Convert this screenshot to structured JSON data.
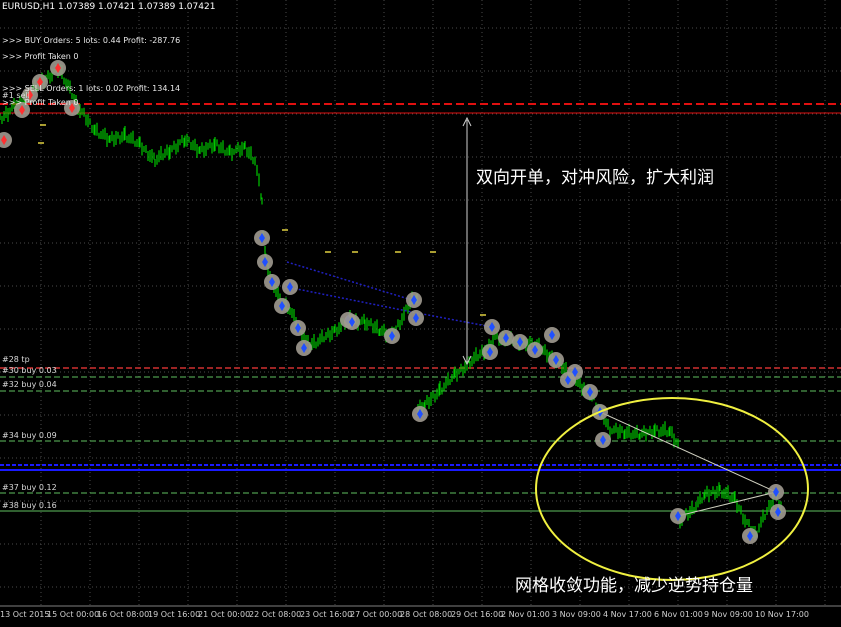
{
  "window": {
    "title": "EURUSD,H1  1.07389 1.07421 1.07389 1.07421"
  },
  "info": {
    "buy_line": ">>> BUY  Orders: 5 lots: 0.44 Profit: -287.76",
    "buy_taken": ">>> Profit Taken 0",
    "sell_line": ">>> SELL Orders: 1 lots: 0.02 Profit: 134.14",
    "sell_taken": ">>> Profit Taken 0"
  },
  "level_labels": {
    "top_sell": "#1 sell",
    "tp": "#28 tp",
    "buy30": "#30 buy 0.03",
    "buy32": "#32 buy 0.04",
    "buy34": "#34 buy 0.09",
    "buy37": "#37 buy 0.12",
    "buy38": "#38 buy 0.16"
  },
  "annotations": {
    "top": "双向开单，对冲风险，扩大利润",
    "bottom": "网格收敛功能，减少逆势持仓量"
  },
  "x_axis": [
    "13 Oct 2015",
    "15 Oct 00:00",
    "16 Oct 08:00",
    "19 Oct 16:00",
    "21 Oct 00:00",
    "22 Oct 08:00",
    "23 Oct 16:00",
    "27 Oct 00:00",
    "28 Oct 08:00",
    "29 Oct 16:00",
    "2 Nov 01:00",
    "3 Nov 09:00",
    "4 Nov 17:00",
    "6 Nov 01:00",
    "9 Nov 09:00",
    "10 Nov 17:00"
  ],
  "colors": {
    "background": "#000000",
    "candles": "#00c800",
    "grid": "#4a4a4a",
    "sell_line": "#e01010",
    "tp_line": "#d03030",
    "buy_line": "#60c060",
    "current_price": "#1a1aff",
    "ellipse": "#f0f040",
    "order_marker": "#a09a90",
    "order_arrow_buy": "#2050ff",
    "order_arrow_sell": "#ff3030",
    "hedge_line": "#2020c0"
  }
}
